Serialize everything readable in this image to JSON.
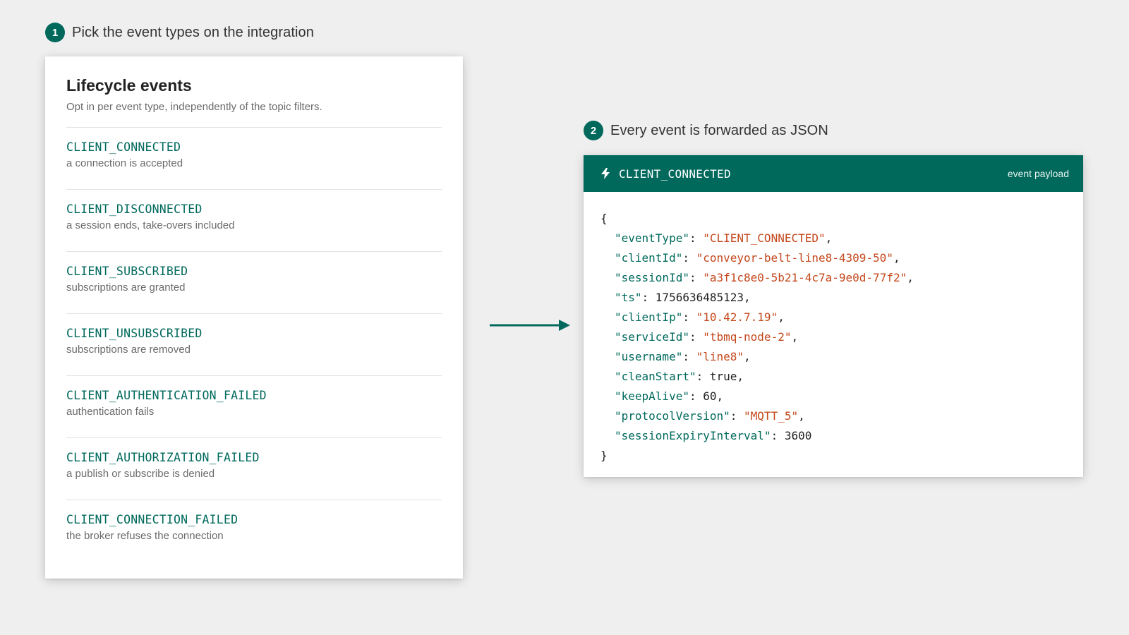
{
  "step1": {
    "number": "1",
    "title": "Pick the event types on the integration"
  },
  "step2": {
    "number": "2",
    "title": "Every event is forwarded as JSON"
  },
  "lifecycle": {
    "title": "Lifecycle events",
    "subtitle": "Opt in per event type, independently of the topic filters.",
    "events": [
      {
        "name": "CLIENT_CONNECTED",
        "description": "a connection is accepted"
      },
      {
        "name": "CLIENT_DISCONNECTED",
        "description": "a session ends, take-overs included"
      },
      {
        "name": "CLIENT_SUBSCRIBED",
        "description": "subscriptions are granted"
      },
      {
        "name": "CLIENT_UNSUBSCRIBED",
        "description": "subscriptions are removed"
      },
      {
        "name": "CLIENT_AUTHENTICATION_FAILED",
        "description": "authentication fails"
      },
      {
        "name": "CLIENT_AUTHORIZATION_FAILED",
        "description": "a publish or subscribe is denied"
      },
      {
        "name": "CLIENT_CONNECTION_FAILED",
        "description": "the broker refuses the connection"
      }
    ]
  },
  "payload": {
    "icon": "bolt-icon",
    "title": "CLIENT_CONNECTED",
    "tag": "event payload",
    "open_brace": "{",
    "close_brace": "}",
    "fields": [
      {
        "key": "\"eventType\"",
        "value": "\"CLIENT_CONNECTED\"",
        "kind": "string",
        "comma": ","
      },
      {
        "key": "\"clientId\"",
        "value": "\"conveyor-belt-line8-4309-50\"",
        "kind": "string",
        "comma": ","
      },
      {
        "key": "\"sessionId\"",
        "value": "\"a3f1c8e0-5b21-4c7a-9e0d-77f2\"",
        "kind": "string",
        "comma": ","
      },
      {
        "key": "\"ts\"",
        "value": "1756636485123",
        "kind": "number",
        "comma": ","
      },
      {
        "key": "\"clientIp\"",
        "value": "\"10.42.7.19\"",
        "kind": "string",
        "comma": ","
      },
      {
        "key": "\"serviceId\"",
        "value": "\"tbmq-node-2\"",
        "kind": "string",
        "comma": ","
      },
      {
        "key": "\"username\"",
        "value": "\"line8\"",
        "kind": "string",
        "comma": ","
      },
      {
        "key": "\"cleanStart\"",
        "value": "true",
        "kind": "number",
        "comma": ","
      },
      {
        "key": "\"keepAlive\"",
        "value": "60",
        "kind": "number",
        "comma": ","
      },
      {
        "key": "\"protocolVersion\"",
        "value": "\"MQTT_5\"",
        "kind": "string",
        "comma": ","
      },
      {
        "key": "\"sessionExpiryInterval\"",
        "value": "3600",
        "kind": "number",
        "comma": ""
      }
    ]
  },
  "colors": {
    "accent": "#00695c",
    "json_string": "#c4481c",
    "background": "#efefef"
  }
}
